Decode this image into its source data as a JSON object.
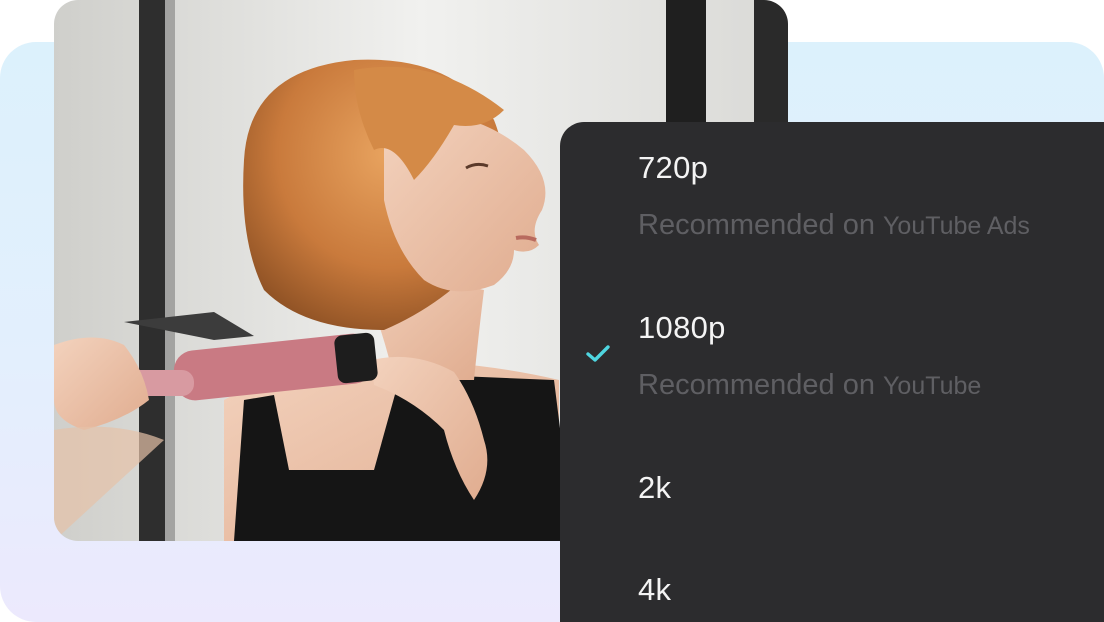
{
  "resolution_menu": {
    "options": [
      {
        "label": "720p",
        "sub_prefix": "Recommended on",
        "sub_platform": "YouTube Ads",
        "selected": false
      },
      {
        "label": "1080p",
        "sub_prefix": "Recommended on",
        "sub_platform": "YouTube",
        "selected": true
      },
      {
        "label": "2k",
        "selected": false
      },
      {
        "label": "4k",
        "selected": false
      }
    ],
    "selected_icon": "checkmark-icon"
  },
  "colors": {
    "menu_background": "#2c2c2e",
    "checkmark": "#4fd6e0",
    "option_text": "#f4f4f4",
    "subtext": "#5f5f63"
  }
}
